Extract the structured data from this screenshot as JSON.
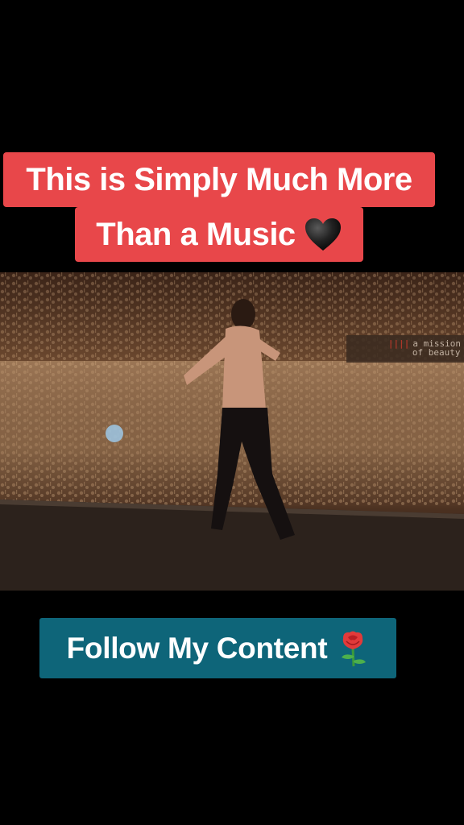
{
  "caption": {
    "line1": "This is Simply Much More",
    "line2": "Than a Music",
    "emoji_icon": "black-heart-icon",
    "background_color": "#e8474a"
  },
  "video": {
    "overlay_line1": "a mission",
    "overlay_line2": "of beauty"
  },
  "cta": {
    "label": "Follow My Content",
    "emoji_icon": "rose-icon",
    "background_color": "#0e6579"
  }
}
